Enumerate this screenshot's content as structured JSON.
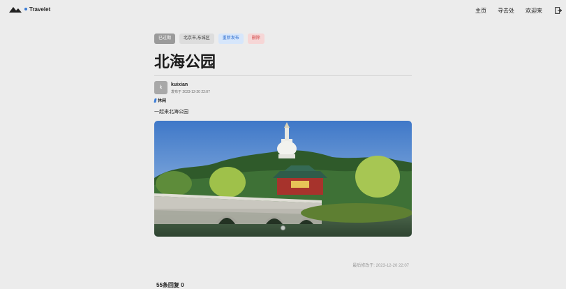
{
  "header": {
    "brand": "Travelet",
    "nav": [
      "主页",
      "寻去处",
      "欢迎来"
    ]
  },
  "article": {
    "tags": {
      "status": "已过期",
      "location": "北京市,东城区",
      "republish": "重新发布",
      "delete": "删除"
    },
    "title": "北海公园",
    "author": {
      "avatar_letter": "k",
      "name": "kuixian",
      "published": "发布于 2023-12-20 22:07"
    },
    "category": "休闲",
    "body": "一起来北海公园",
    "modified": "最后修改于: 2023-12-20 22:07",
    "comments_heading": "55条回复 0"
  },
  "colors": {
    "background": "#ececec",
    "accent": "#3a7bd5",
    "delete": "#d24545"
  }
}
